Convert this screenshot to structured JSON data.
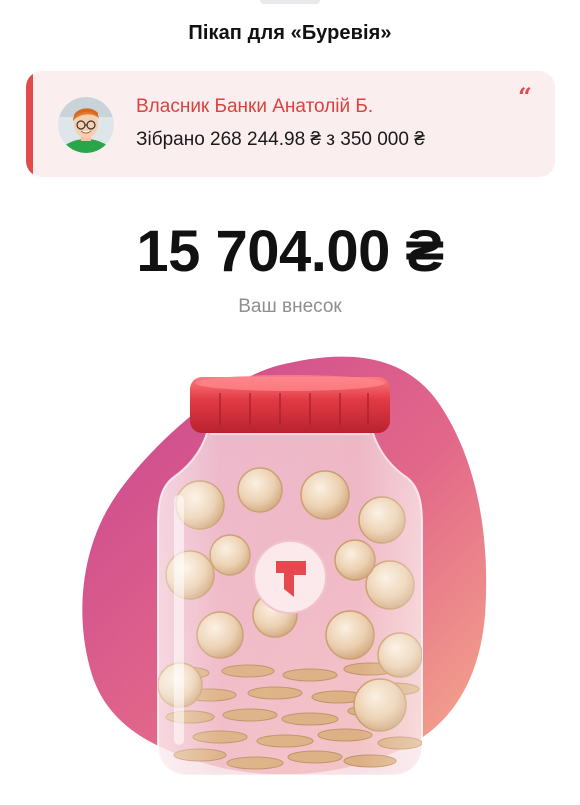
{
  "header": {
    "title": "Пікап для «Буревія»"
  },
  "owner_card": {
    "name": "Власник Банки Анатолій Б.",
    "collected": "Зібрано 268 244.98 ₴ з 350 000 ₴",
    "quote_symbol": "“",
    "avatar_icon": "person-avatar",
    "accent_color": "#e14b4b"
  },
  "contribution": {
    "amount": "15 704.00 ₴",
    "caption": "Ваш внесок"
  },
  "illustration": {
    "icon": "coin-jar-illustration",
    "logo_icon": "monobank-flag-logo",
    "blob_color_start": "#cf4a8c",
    "blob_color_end": "#f4a48a",
    "lid_color": "#d9353e"
  }
}
